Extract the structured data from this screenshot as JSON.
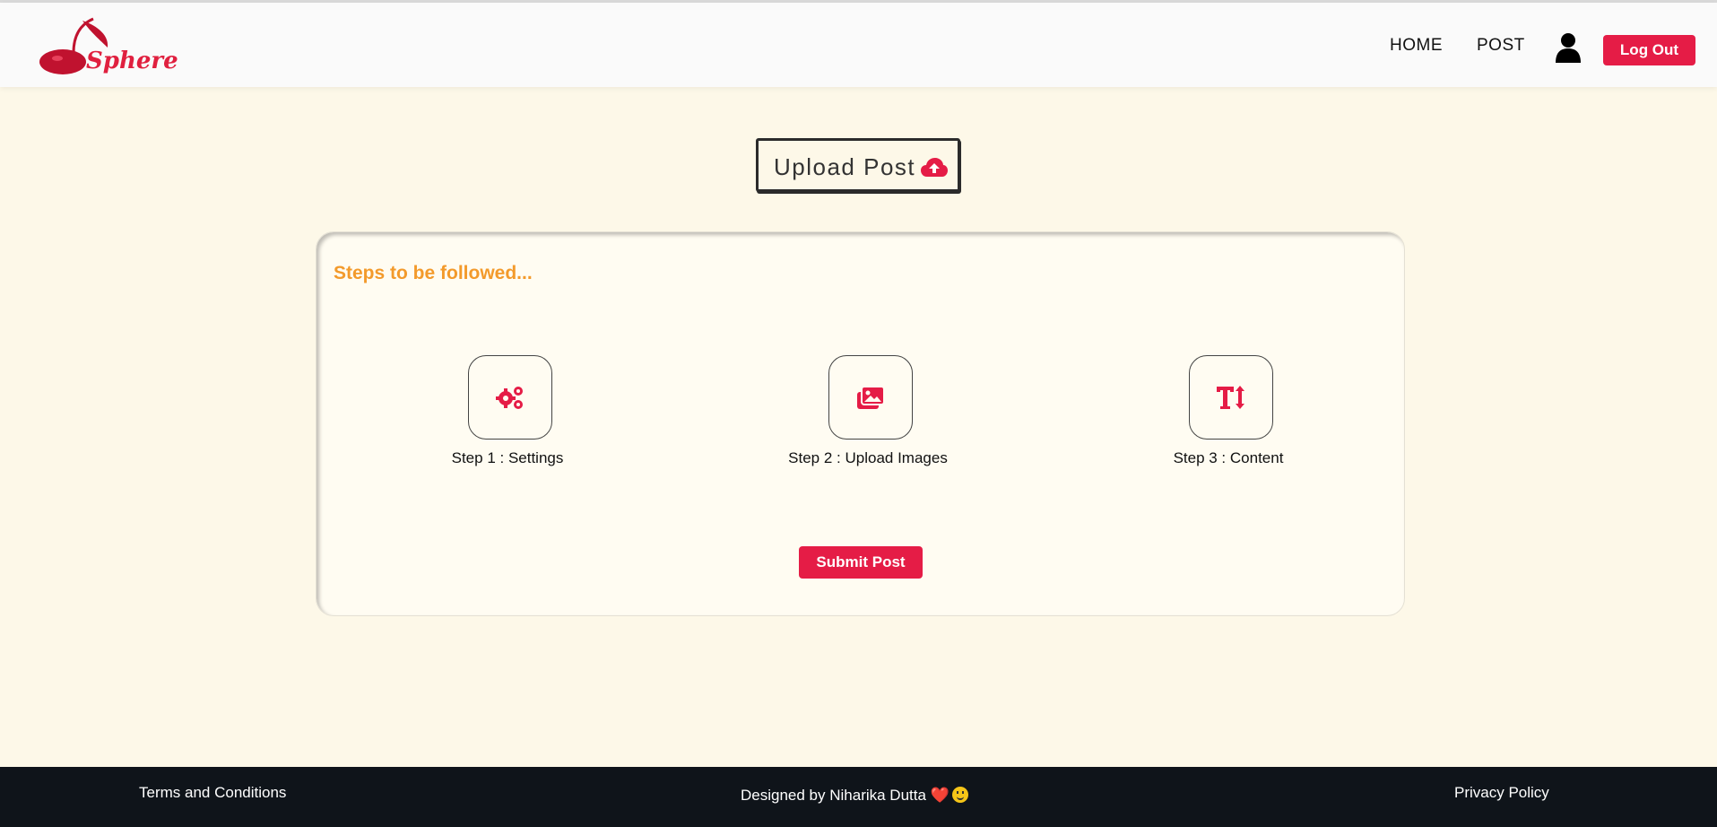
{
  "app": {
    "brand_text": "Sphere",
    "accent_color": "#e51c46",
    "heading_color": "#f39a2b"
  },
  "nav": {
    "home_label": "HOME",
    "post_label": "POST",
    "user_icon": "user-icon",
    "logout_label": "Log Out"
  },
  "page": {
    "title": "Upload Post",
    "title_icon": "cloud-upload-icon"
  },
  "steps": {
    "heading": "Steps to be followed...",
    "items": [
      {
        "label": "Step 1 : Settings",
        "icon": "gears-icon"
      },
      {
        "label": "Step 2 : Upload Images",
        "icon": "images-icon"
      },
      {
        "label": "Step 3 : Content",
        "icon": "text-height-icon"
      }
    ],
    "submit_label": "Submit Post"
  },
  "footer": {
    "terms_label": "Terms and Conditions",
    "credit_text": "Designed by Niharika Dutta",
    "heart": "❤️",
    "privacy_label": "Privacy Policy"
  }
}
